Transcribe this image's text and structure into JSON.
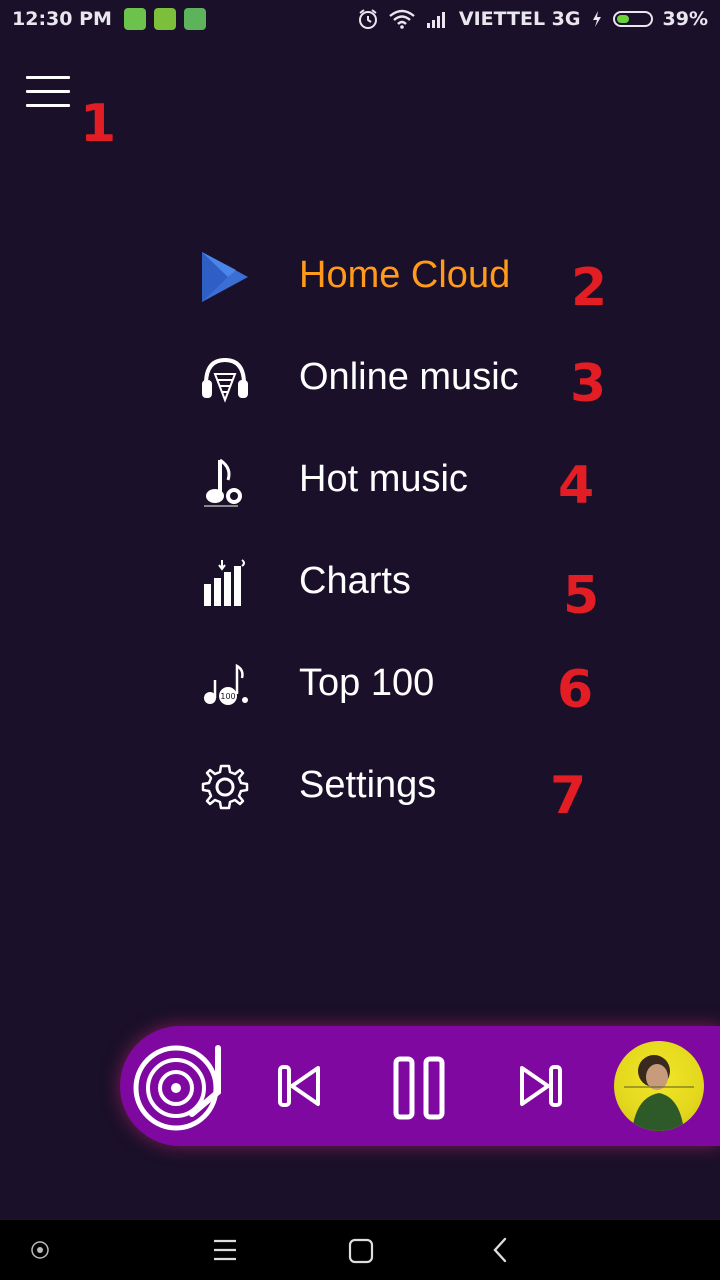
{
  "status_bar": {
    "time": "12:30 PM",
    "carrier": "VIETTEL 3G",
    "battery": "39%",
    "battery_level": 0.39,
    "icons": [
      "sim-icon",
      "android-icon",
      "android-icon",
      "alarm-icon",
      "wifi-icon",
      "signal-icon",
      "charging-icon",
      "battery-icon"
    ]
  },
  "annotations": [
    "1",
    "2",
    "3",
    "4",
    "5",
    "6",
    "7"
  ],
  "menu": {
    "items": [
      {
        "label": "Home Cloud",
        "icon": "play-triangle-icon",
        "active": true
      },
      {
        "label": "Online music",
        "icon": "headphones-icon",
        "active": false
      },
      {
        "label": "Hot music",
        "icon": "music-note-icon",
        "active": false
      },
      {
        "label": "Charts",
        "icon": "equalizer-icon",
        "active": false
      },
      {
        "label": "Top 100",
        "icon": "top100-notes-icon",
        "active": false
      },
      {
        "label": "Settings",
        "icon": "gear-icon",
        "active": false
      }
    ]
  },
  "player": {
    "icons": [
      "turntable-icon",
      "previous-icon",
      "pause-icon",
      "next-icon",
      "album-art"
    ],
    "accent": "#7f09a0"
  },
  "nav_bar": {
    "icons": [
      "assist-dot-icon",
      "menu-icon",
      "home-square-icon",
      "back-icon"
    ]
  },
  "colors": {
    "background": "#1a1029",
    "active_label": "#ff9a1a",
    "annotation": "#e21d24"
  }
}
